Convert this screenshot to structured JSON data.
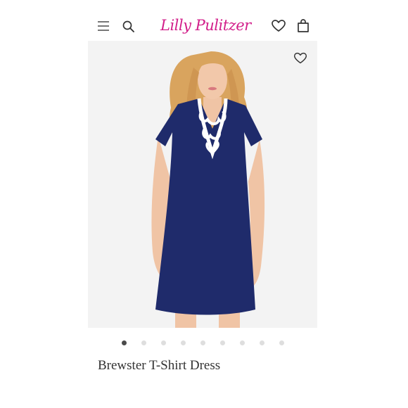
{
  "header": {
    "logo_text": "Lilly Pulitzer",
    "icons": [
      "menu-icon",
      "search-icon",
      "heart-icon",
      "shopping-bag-icon"
    ]
  },
  "product": {
    "title": "Brewster T-Shirt Dress",
    "image_count": 9,
    "active_image": 1,
    "image_description_colors": {
      "dress": "#1f2b6b",
      "trim": "#ffffff",
      "background": "#f3f3f3"
    }
  },
  "colors": {
    "brand": "#d21e8a",
    "icon": "#333333"
  }
}
